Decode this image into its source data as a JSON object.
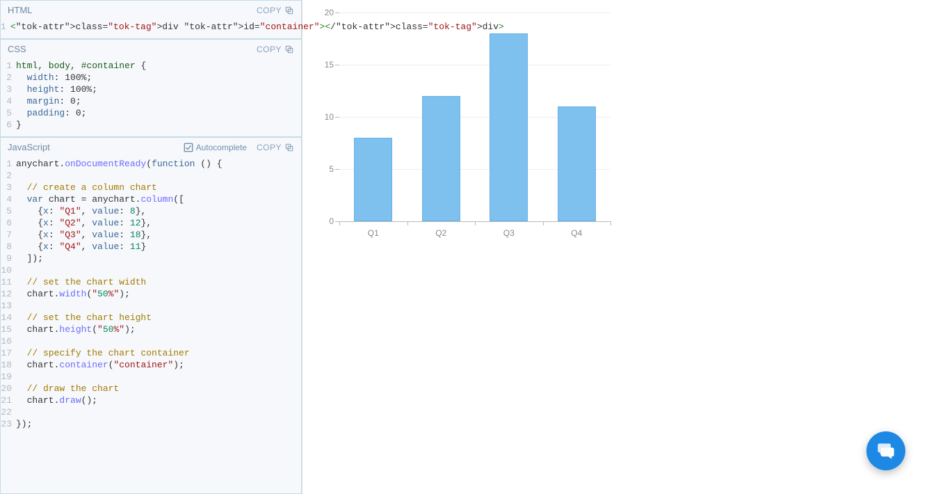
{
  "panels": {
    "html": {
      "title": "HTML",
      "copy_label": "COPY"
    },
    "css": {
      "title": "CSS",
      "copy_label": "COPY"
    },
    "js": {
      "title": "JavaScript",
      "copy_label": "COPY",
      "autocomplete_label": "Autocomplete"
    }
  },
  "code": {
    "html_lines": [
      "<div id=\"container\"></div>"
    ],
    "css_lines": [
      "html, body, #container {",
      "  width: 100%;",
      "  height: 100%;",
      "  margin: 0;",
      "  padding: 0;",
      "}"
    ],
    "js_lines": [
      "anychart.onDocumentReady(function () {",
      "",
      "  // create a column chart",
      "  var chart = anychart.column([",
      "    {x: \"Q1\", value: 8},",
      "    {x: \"Q2\", value: 12},",
      "    {x: \"Q3\", value: 18},",
      "    {x: \"Q4\", value: 11}",
      "  ]);",
      "",
      "  // set the chart width",
      "  chart.width(\"50%\");",
      "",
      "  // set the chart height",
      "  chart.height(\"50%\");",
      "",
      "  // specify the chart container",
      "  chart.container(\"container\");",
      "",
      "  // draw the chart",
      "  chart.draw();",
      "",
      "});"
    ]
  },
  "chart_data": {
    "type": "bar",
    "categories": [
      "Q1",
      "Q2",
      "Q3",
      "Q4"
    ],
    "values": [
      8,
      12,
      18,
      11
    ],
    "title": "",
    "xlabel": "",
    "ylabel": "",
    "ylim": [
      0,
      20
    ],
    "yticks": [
      0,
      5,
      10,
      15,
      20
    ]
  }
}
